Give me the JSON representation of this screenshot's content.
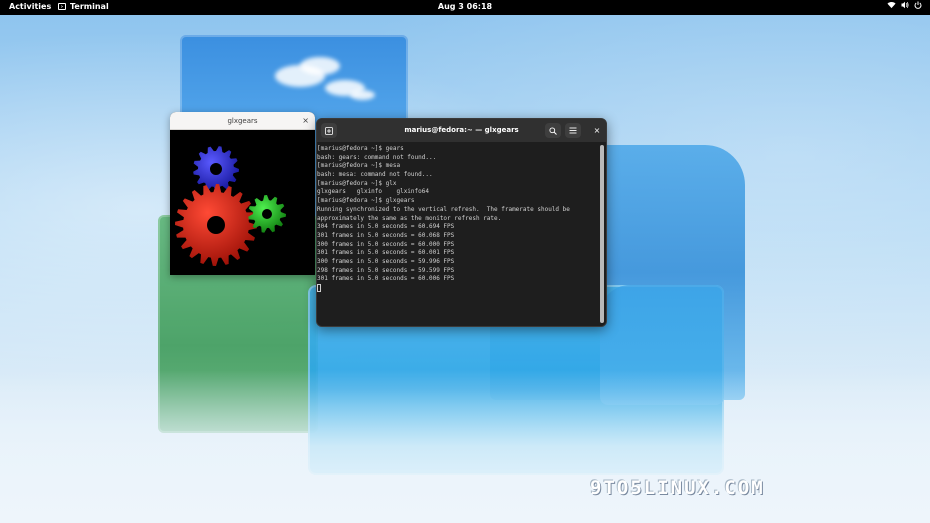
{
  "topbar": {
    "activities": "Activities",
    "app_menu": "Terminal",
    "clock": "Aug 3  06:18",
    "icons": [
      "wifi-icon",
      "volume-icon",
      "power-icon"
    ]
  },
  "glxgears": {
    "title": "glxgears",
    "close": "×"
  },
  "terminal": {
    "title": "marius@fedora:~ — glxgears",
    "close": "×",
    "lines": [
      "[marius@fedora ~]$ gears",
      "bash: gears: command not found...",
      "[marius@fedora ~]$ mesa",
      "bash: mesa: command not found...",
      "[marius@fedora ~]$ glx",
      "glxgears   glxinfo    glxinfo64",
      "[marius@fedora ~]$ glxgears",
      "Running synchronized to the vertical refresh.  The framerate should be",
      "approximately the same as the monitor refresh rate.",
      "304 frames in 5.0 seconds = 60.694 FPS",
      "301 frames in 5.0 seconds = 60.068 FPS",
      "300 frames in 5.0 seconds = 60.000 FPS",
      "301 frames in 5.0 seconds = 60.001 FPS",
      "300 frames in 5.0 seconds = 59.996 FPS",
      "298 frames in 5.0 seconds = 59.599 FPS",
      "301 frames in 5.0 seconds = 60.006 FPS"
    ]
  },
  "watermark": "9TO5LINUX.COM",
  "colors": {
    "topbar": "#000000",
    "terminal_bg": "#1e1e1e",
    "terminal_header": "#303030",
    "gear_red": "#d81e12",
    "gear_green": "#1fb51f",
    "gear_blue": "#2a2ad8"
  }
}
